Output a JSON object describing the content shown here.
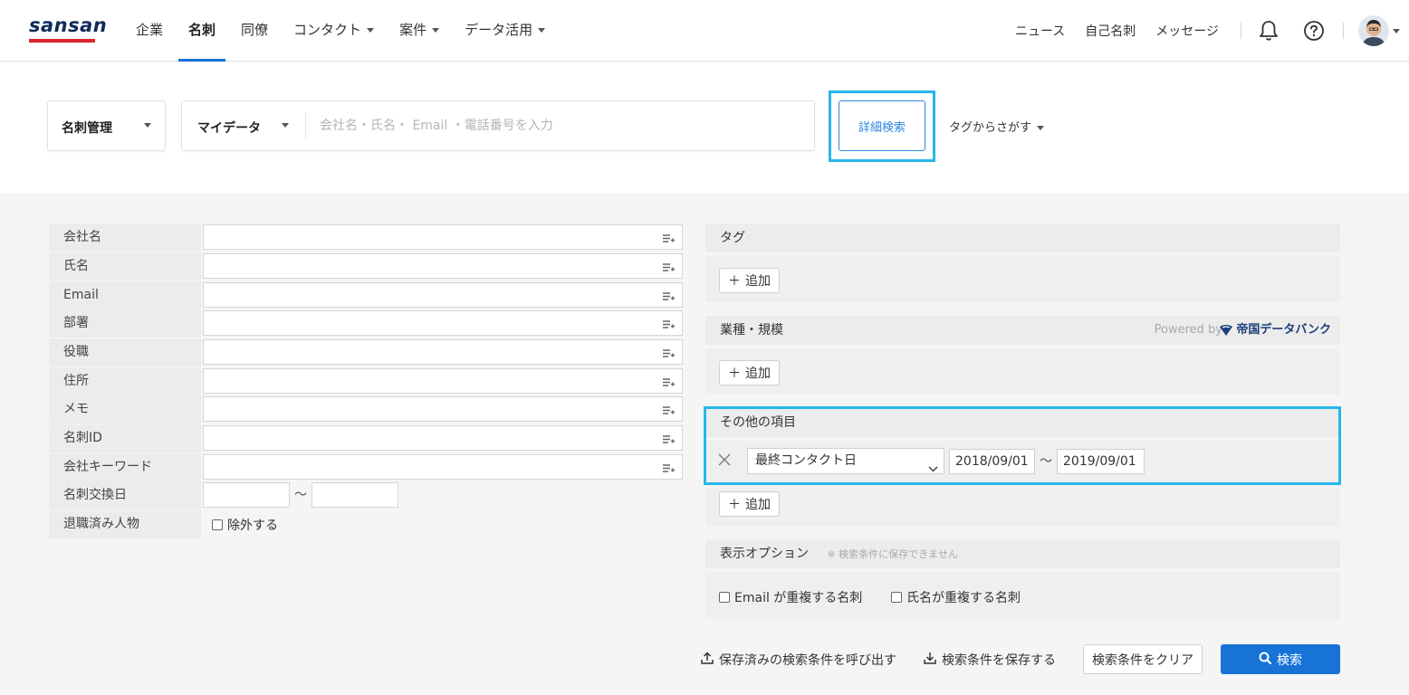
{
  "header": {
    "logo": "sansan",
    "nav": [
      {
        "label": "企業",
        "dropdown": false,
        "active": false
      },
      {
        "label": "名刺",
        "dropdown": false,
        "active": true
      },
      {
        "label": "同僚",
        "dropdown": false,
        "active": false
      },
      {
        "label": "コンタクト",
        "dropdown": true,
        "active": false
      },
      {
        "label": "案件",
        "dropdown": true,
        "active": false
      },
      {
        "label": "データ活用",
        "dropdown": true,
        "active": false
      }
    ],
    "right_links": [
      "ニュース",
      "自己名刺",
      "メッセージ"
    ],
    "icons": [
      "bell-icon",
      "help-icon",
      "avatar"
    ]
  },
  "search": {
    "scope_select": "名刺管理",
    "data_select": "マイデータ",
    "placeholder": "会社名・氏名・ Email ・電話番号を入力",
    "advanced_button": "詳細検索",
    "tag_search": "タグからさがす"
  },
  "left_form": {
    "rows": [
      {
        "label": "会社名"
      },
      {
        "label": "氏名"
      },
      {
        "label": "Email"
      },
      {
        "label": "部署"
      },
      {
        "label": "役職"
      },
      {
        "label": "住所"
      },
      {
        "label": "メモ"
      },
      {
        "label": "名刺ID"
      },
      {
        "label": "会社キーワード"
      }
    ],
    "exchange_date_label": "名刺交換日",
    "tilde": "〜",
    "retired_label": "退職済み人物",
    "exclude_label": "除外する"
  },
  "right_panel": {
    "tag_header": "タグ",
    "add_label": "追加",
    "industry_header": "業種・規模",
    "powered_by": "Powered by",
    "provider": "帝国データバンク",
    "other_header": "その他の項目",
    "other_field_select": "最終コンタクト日",
    "date_from": "2018/09/01",
    "date_to": "2019/09/01",
    "display_options_header": "表示オプション",
    "display_options_note": "※ 検索条件に保存できません",
    "dup_email": "Email が重複する名刺",
    "dup_name": "氏名が重複する名刺"
  },
  "actions": {
    "load_saved": "保存済みの検索条件を呼び出す",
    "save": "検索条件を保存する",
    "clear": "検索条件をクリア",
    "search": "検索"
  },
  "colors": {
    "accent_blue": "#1773d6",
    "highlight_cyan": "#26b6ec",
    "logo_navy": "#0f2b5b",
    "logo_red": "#d8262d"
  }
}
